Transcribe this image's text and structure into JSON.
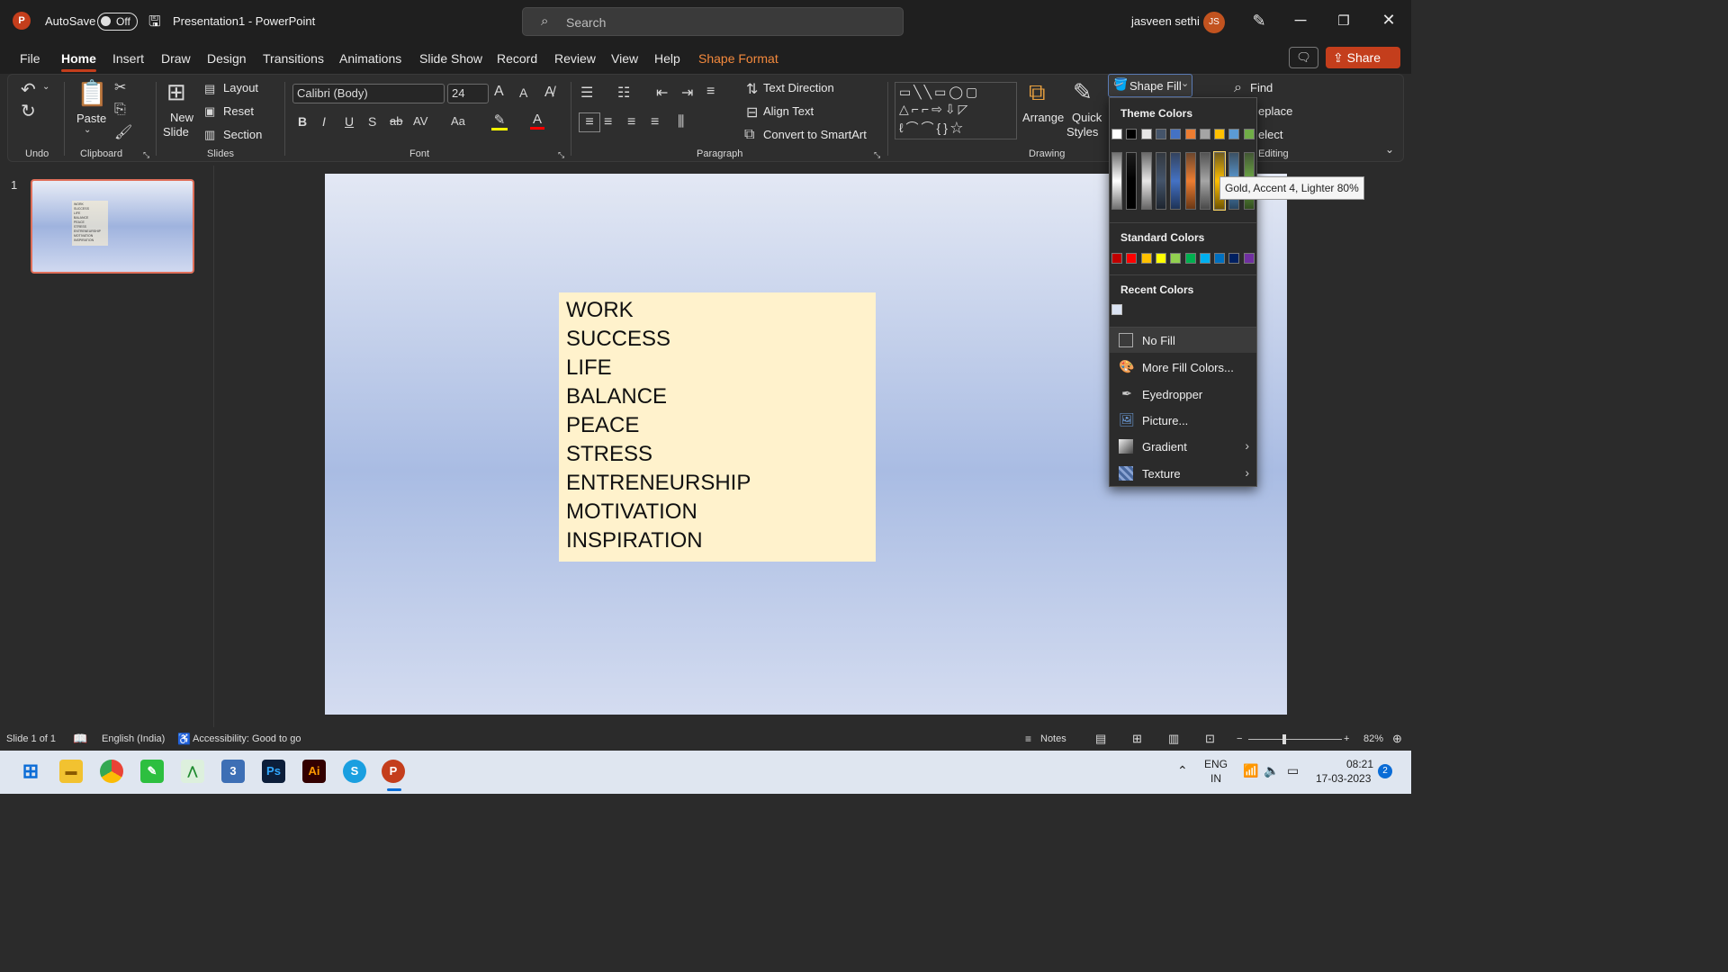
{
  "titlebar": {
    "autosave_label": "AutoSave",
    "autosave_state": "Off",
    "doc_title": "Presentation1  -  PowerPoint",
    "search_placeholder": "Search",
    "user_name": "jasveen sethi",
    "user_initials": "JS"
  },
  "tabs": [
    "File",
    "Home",
    "Insert",
    "Draw",
    "Design",
    "Transitions",
    "Animations",
    "Slide Show",
    "Record",
    "Review",
    "View",
    "Help",
    "Shape Format"
  ],
  "share_label": "Share",
  "ribbon": {
    "groups": {
      "undo": "Undo",
      "clipboard": "Clipboard",
      "slides": "Slides",
      "font": "Font",
      "paragraph": "Paragraph",
      "drawing": "Drawing",
      "editing": "Editing"
    },
    "paste": "Paste",
    "new_slide_1": "New",
    "new_slide_2": "Slide",
    "layout": "Layout",
    "reset": "Reset",
    "section": "Section",
    "font_name": "Calibri (Body)",
    "font_size": "24",
    "text_direction": "Text Direction",
    "align_text": "Align Text",
    "convert_smartart": "Convert to SmartArt",
    "arrange": "Arrange",
    "quick_styles_1": "Quick",
    "quick_styles_2": "Styles",
    "shape_fill": "Shape Fill",
    "find": "Find",
    "replace": "eplace",
    "select": "elect"
  },
  "slide_panel": {
    "number": "1"
  },
  "slide": {
    "words": [
      "WORK",
      "SUCCESS",
      "LIFE",
      "BALANCE",
      "PEACE",
      "STRESS",
      "ENTRENEURSHIP",
      "MOTIVATION",
      "INSPIRATION"
    ],
    "textbox_fill": "#fff2cc"
  },
  "dropdown": {
    "theme_colors_label": "Theme Colors",
    "standard_colors_label": "Standard Colors",
    "recent_colors_label": "Recent Colors",
    "theme_colors": [
      "#ffffff",
      "#000000",
      "#e7e6e6",
      "#44546a",
      "#4472c4",
      "#ed7d31",
      "#a5a5a5",
      "#ffc000",
      "#5b9bd5",
      "#70ad47"
    ],
    "standard_colors": [
      "#c00000",
      "#ff0000",
      "#ffc000",
      "#ffff00",
      "#92d050",
      "#00b050",
      "#00b0f0",
      "#0070c0",
      "#002060",
      "#7030a0"
    ],
    "recent_colors": [
      "#dae3f3"
    ],
    "items": [
      {
        "label": "No Fill",
        "icon": "no-fill-icon"
      },
      {
        "label": "More Fill Colors...",
        "icon": "palette-icon"
      },
      {
        "label": "Eyedropper",
        "icon": "eyedropper-icon"
      },
      {
        "label": "Picture...",
        "icon": "picture-icon"
      },
      {
        "label": "Gradient",
        "icon": "gradient-icon"
      },
      {
        "label": "Texture",
        "icon": "texture-icon"
      }
    ],
    "tooltip": "Gold, Accent 4, Lighter 80%"
  },
  "statusbar": {
    "slide_info": "Slide 1 of 1",
    "language": "English (India)",
    "accessibility": "Accessibility: Good to go",
    "notes": "Notes",
    "zoom": "82%"
  },
  "taskbar": {
    "lang_1": "ENG",
    "lang_2": "IN",
    "time": "08:21",
    "date": "17-03-2023",
    "notification_count": "2"
  }
}
